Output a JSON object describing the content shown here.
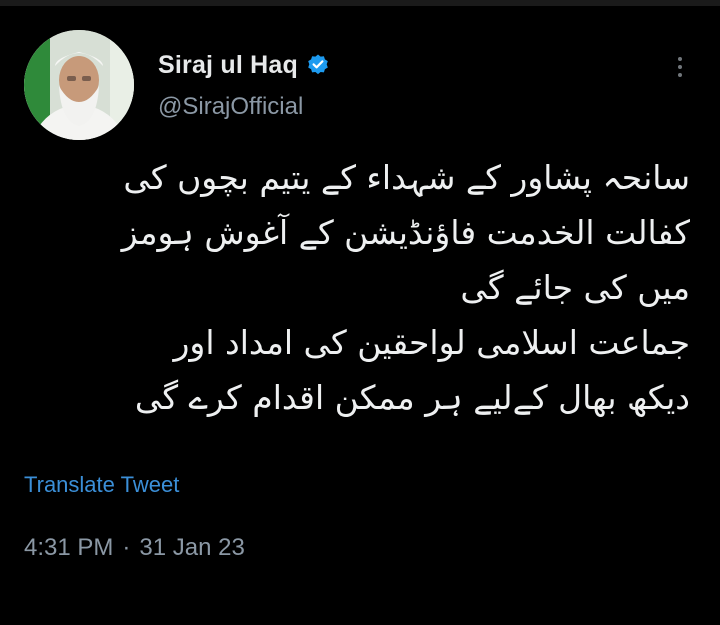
{
  "author": {
    "display_name": "Siraj ul Haq",
    "handle": "@SirajOfficial",
    "verified": true,
    "verified_color": "#1d9bf0"
  },
  "tweet": {
    "lines": [
      "سانحہ پشاور کے شہداء کے یتیم بچوں کی",
      "کفالت الخدمت فاؤنڈیشن کے آغوش ہومز",
      "میں کی جائے گی",
      "جماعت اسلامی لواحقین کی امداد اور",
      "دیکھ بھال کےلیے ہر ممکن اقدام کرے گی"
    ]
  },
  "actions": {
    "translate_label": "Translate Tweet"
  },
  "meta": {
    "time": "4:31 PM",
    "separator": "·",
    "date": "31 Jan 23"
  },
  "icons": {
    "more": "more-vertical-icon",
    "verified": "verified-badge-icon"
  },
  "colors": {
    "background": "#000000",
    "text": "#e7e9ea",
    "secondary_text": "#8b98a5",
    "link": "#3b8fd8"
  }
}
